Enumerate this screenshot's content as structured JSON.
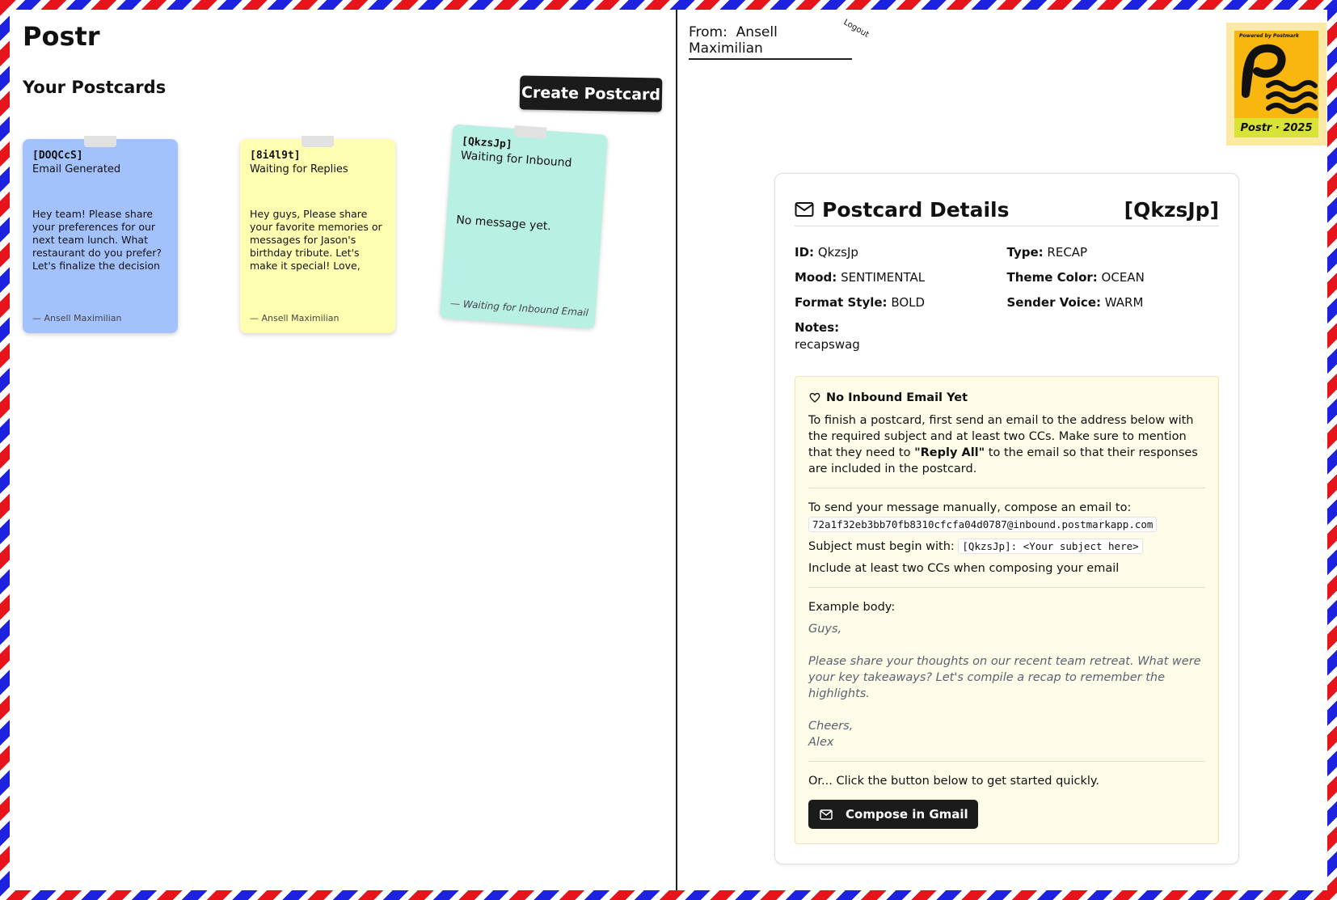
{
  "app": {
    "title": "Postr"
  },
  "list": {
    "title": "Your Postcards",
    "create_button": "Create Postcard",
    "cards": [
      {
        "id": "[DOQCcS]",
        "status": "Email Generated",
        "message": "Hey team! Please share your preferences for our next team lunch. What restaurant do you prefer? Let's finalize the decision b...",
        "signature": "— Ansell Maximilian",
        "color": "#a3c2fd"
      },
      {
        "id": "[8i4l9t]",
        "status": "Waiting for Replies",
        "message": "Hey guys, Please share your favorite memories or messages for Jason's birthday tribute. Let's make it special! Love, Ansell",
        "signature": "— Ansell Maximilian",
        "color": "#fefeb0"
      },
      {
        "id": "[QkzsJp]",
        "status": "Waiting for Inbound",
        "message": "No message yet.",
        "signature": "— Waiting for Inbound Email",
        "color": "#b8f0e3"
      }
    ]
  },
  "header": {
    "from_prefix": "From:",
    "from_name": "Ansell Maximilian",
    "logout": "Logout"
  },
  "stamp": {
    "top_text": "Powered by Postmark",
    "footer": "Postr · 2025",
    "bg": "#f8b60f"
  },
  "details": {
    "title": "Postcard Details",
    "code": "[QkzsJp]",
    "fields": {
      "id_label": "ID:",
      "id": "QkzsJp",
      "type_label": "Type:",
      "type": "RECAP",
      "mood_label": "Mood:",
      "mood": "SENTIMENTAL",
      "theme_label": "Theme Color:",
      "theme": "OCEAN",
      "format_label": "Format Style:",
      "format": "BOLD",
      "voice_label": "Sender Voice:",
      "voice": "WARM",
      "notes_label": "Notes:",
      "notes": "recapswag"
    },
    "inbound": {
      "title": "No Inbound Email Yet",
      "intro_pre": "To finish a postcard, first send an email to the address below with the required subject and at least two CCs. Make sure to mention that they need to ",
      "intro_bold": "\"Reply All\"",
      "intro_post": " to the email so that their responses are included in the postcard.",
      "manual_label": "To send your message manually, compose an email to:",
      "address": "72a1f32eb3bb70fb8310cfcfa04d0787@inbound.postmarkapp.com",
      "subject_label": "Subject must begin with:",
      "subject": "[QkzsJp]: <Your subject here>",
      "cc_note": "Include at least two CCs when composing your email",
      "example_label": "Example body:",
      "example_greeting": "Guys,",
      "example_body": "Please share your thoughts on our recent team retreat. What were your key takeaways? Let's compile a recap to remember the highlights.",
      "example_closing": "Cheers,",
      "example_name": "Alex",
      "quick_text": "Or... Click the button below to get started quickly.",
      "gmail_button": "Compose in Gmail"
    }
  }
}
